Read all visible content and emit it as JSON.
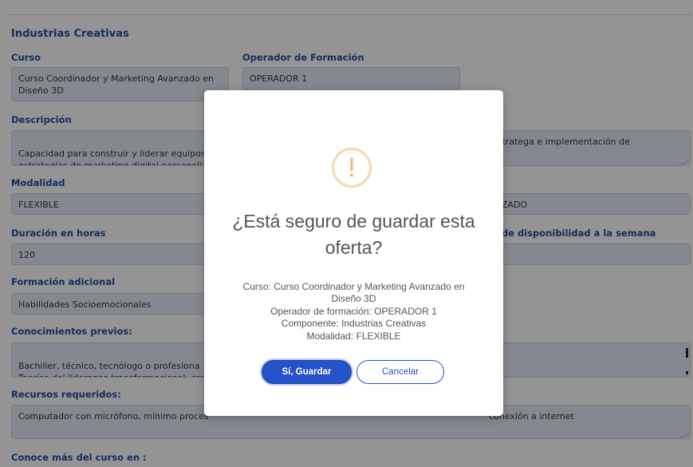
{
  "form": {
    "section_title": "Industrias Creativas",
    "curso_label": "Curso",
    "curso_value": "Curso Coordinador y Marketing Avanzado en Diseño 3D",
    "operador_label": "Operador de Formación",
    "operador_value": "OPERADOR 1",
    "descripcion_label": "Descripción",
    "descripcion_value_left": "Capacidad para construir y liderar equipos c\nestrategias de marketing digital personaliza",
    "descripcion_value_right": "estratega  e implementación de",
    "modalidad_label": "Modalidad",
    "modalidad_value": "FLEXIBLE",
    "nivel_value_visible": "ZADO",
    "duracion_label": "Duración en horas",
    "duracion_value": "120",
    "disponibilidad_label_visible": "de disponibilidad a la semana",
    "formacion_label": "Formación adicional",
    "formacion_value": "Habilidades Socioemocionales",
    "conocimientos_label": "Conocimientos previos:",
    "conocimientos_value": "Bachiller, técnico, tecnólogo o profesiona\nTeorías del liderazgo transformacional, crea",
    "recursos_label": "Recursos requeridos:",
    "recursos_value_left": "Computador con micrófono, mínimo proces",
    "recursos_value_right": "conexión a internet",
    "conoce_label": "Conoce más del curso en :"
  },
  "dialog": {
    "icon": "!",
    "title": "¿Está seguro de guardar esta oferta?",
    "line1": "Curso: Curso Coordinador y Marketing Avanzado en Diseño 3D",
    "line2": "Operador de formación: OPERADOR 1",
    "line3": "Componente: Industrias Creativas",
    "line4": "Modalidad: FLEXIBLE",
    "confirm_label": "Sí, Guardar",
    "cancel_label": "Cancelar"
  }
}
